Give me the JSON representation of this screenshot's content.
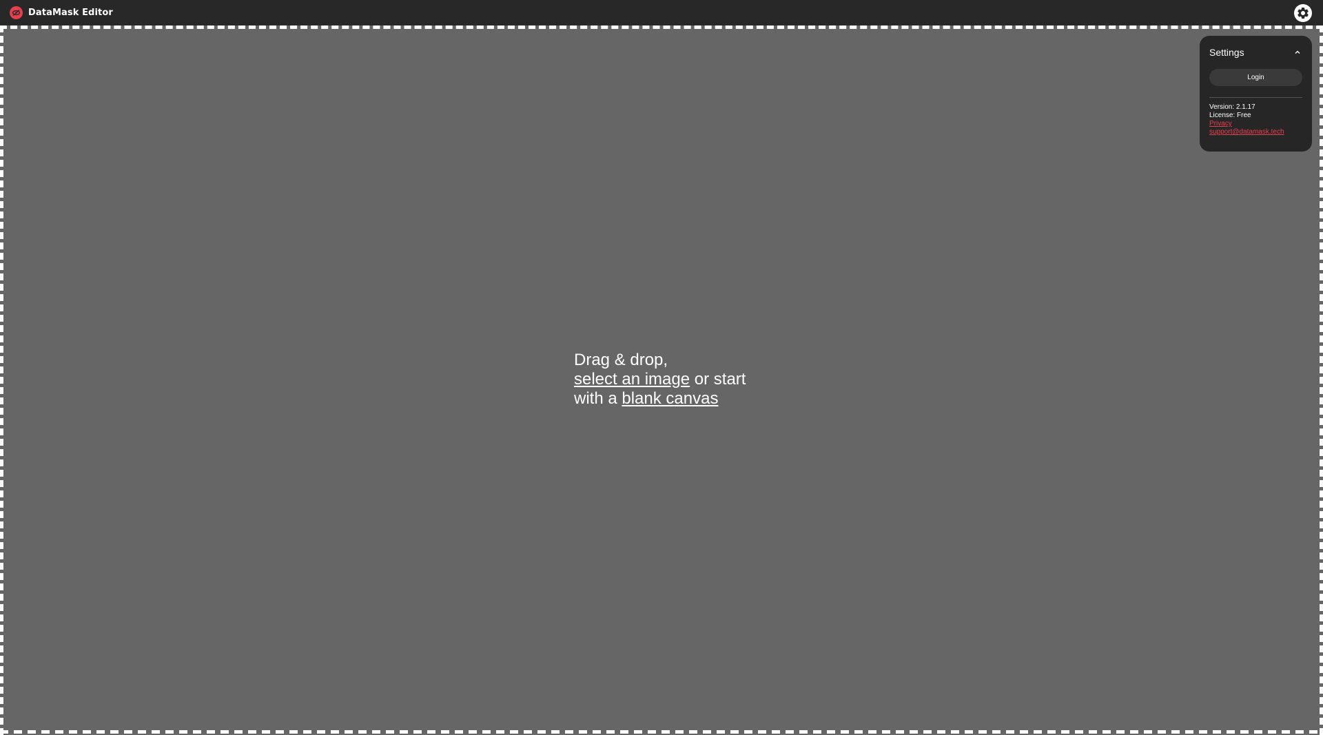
{
  "header": {
    "app_title": "DataMask Editor",
    "logo_icon": "eye-slash-icon",
    "settings_icon": "gear-icon"
  },
  "dropzone": {
    "line1": "Drag & drop,",
    "select_link": "select an image",
    "mid_text": " or start",
    "line3_prefix": "with a ",
    "blank_link": "blank canvas"
  },
  "settings_panel": {
    "title": "Settings",
    "collapse_icon": "chevron-up-icon",
    "login_label": "Login",
    "version": "Version: 2.1.17",
    "license": "License: Free",
    "privacy_link": "Privacy",
    "support_link": "support@datamask.tech"
  },
  "colors": {
    "accent": "#e6404f",
    "topbar": "#282828",
    "canvas": "#666666",
    "panel": "#262626"
  }
}
